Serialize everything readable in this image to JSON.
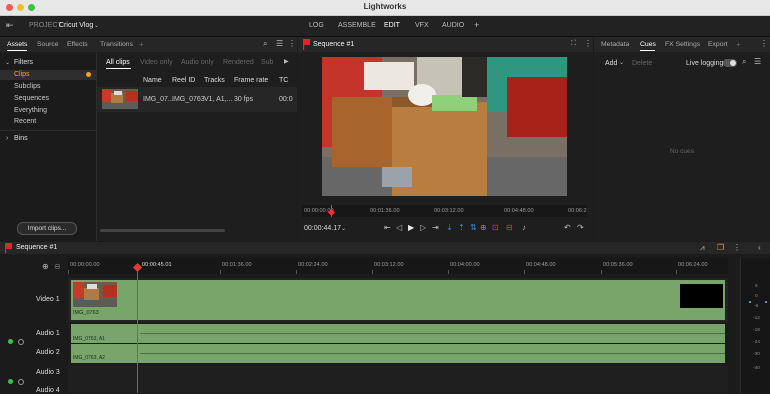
{
  "window": {
    "title": "Lightworks"
  },
  "topbar": {
    "project_prefix": "PROJECT",
    "project_name": "Cricut Vlog",
    "tabs": [
      "LOG",
      "ASSEMBLE",
      "EDIT",
      "VFX",
      "AUDIO"
    ],
    "active_tab": "EDIT",
    "add_tab_glyph": "+"
  },
  "left_panel": {
    "tabs": [
      "Assets",
      "Source",
      "Effects",
      "Transitions"
    ],
    "add_glyph": "+",
    "filters_label": "Filters",
    "filter_items": [
      "Clips",
      "Subclips",
      "Sequences",
      "Everything",
      "Recent"
    ],
    "bins_label": "Bins",
    "import_button": "Import clips...",
    "clip_tabs": [
      "All clips",
      "Video only",
      "Audio only",
      "Rendered",
      "Sub"
    ],
    "columns": [
      "Name",
      "Reel ID",
      "Tracks",
      "Frame rate",
      "TC"
    ],
    "rows": [
      {
        "name": "IMG_07...",
        "reel": "IMG_0763",
        "tracks": "V1, A1,...",
        "frame_rate": "30 fps",
        "tc": "00:0"
      }
    ]
  },
  "viewer": {
    "title": "Sequence #1",
    "ruler": [
      "00:00:00.00",
      "00:01:36.00",
      "00:03:12.00",
      "00:04:48.00",
      "00:06:2"
    ],
    "timecode": "00:00:44.17"
  },
  "right_panel": {
    "tabs": [
      "Metadata",
      "Cues",
      "FX Settings",
      "Export"
    ],
    "active_tab": "Cues",
    "add_label": "Add",
    "delete_label": "Delete",
    "live_logging_label": "Live logging",
    "empty_label": "No cues"
  },
  "timeline": {
    "title": "Sequence #1",
    "ruler": [
      "00:00:00.00",
      "00:00:45.01",
      "00:01:36.00",
      "00:02:24.00",
      "00:03:12.00",
      "00:04:00.00",
      "00:04:48.00",
      "00:05:36.00",
      "00:06:24.00"
    ],
    "tracks": [
      "Video 1",
      "Audio 1",
      "Audio 2",
      "Audio 3",
      "Audio 4"
    ],
    "video_clip_label": "IMG_0763",
    "audio_clip_labels": [
      "IMG_0763, A1",
      "IMG_0763, A2"
    ],
    "meter_labels": [
      "6",
      "0",
      "-6",
      "-12",
      "-18",
      "-24",
      "-30",
      "-40"
    ]
  },
  "colors": {
    "accent_orange": "#f0a22a",
    "clip_green": "#77a56a",
    "playhead_red": "#e53935",
    "sequence_flag": "#e0242b"
  }
}
